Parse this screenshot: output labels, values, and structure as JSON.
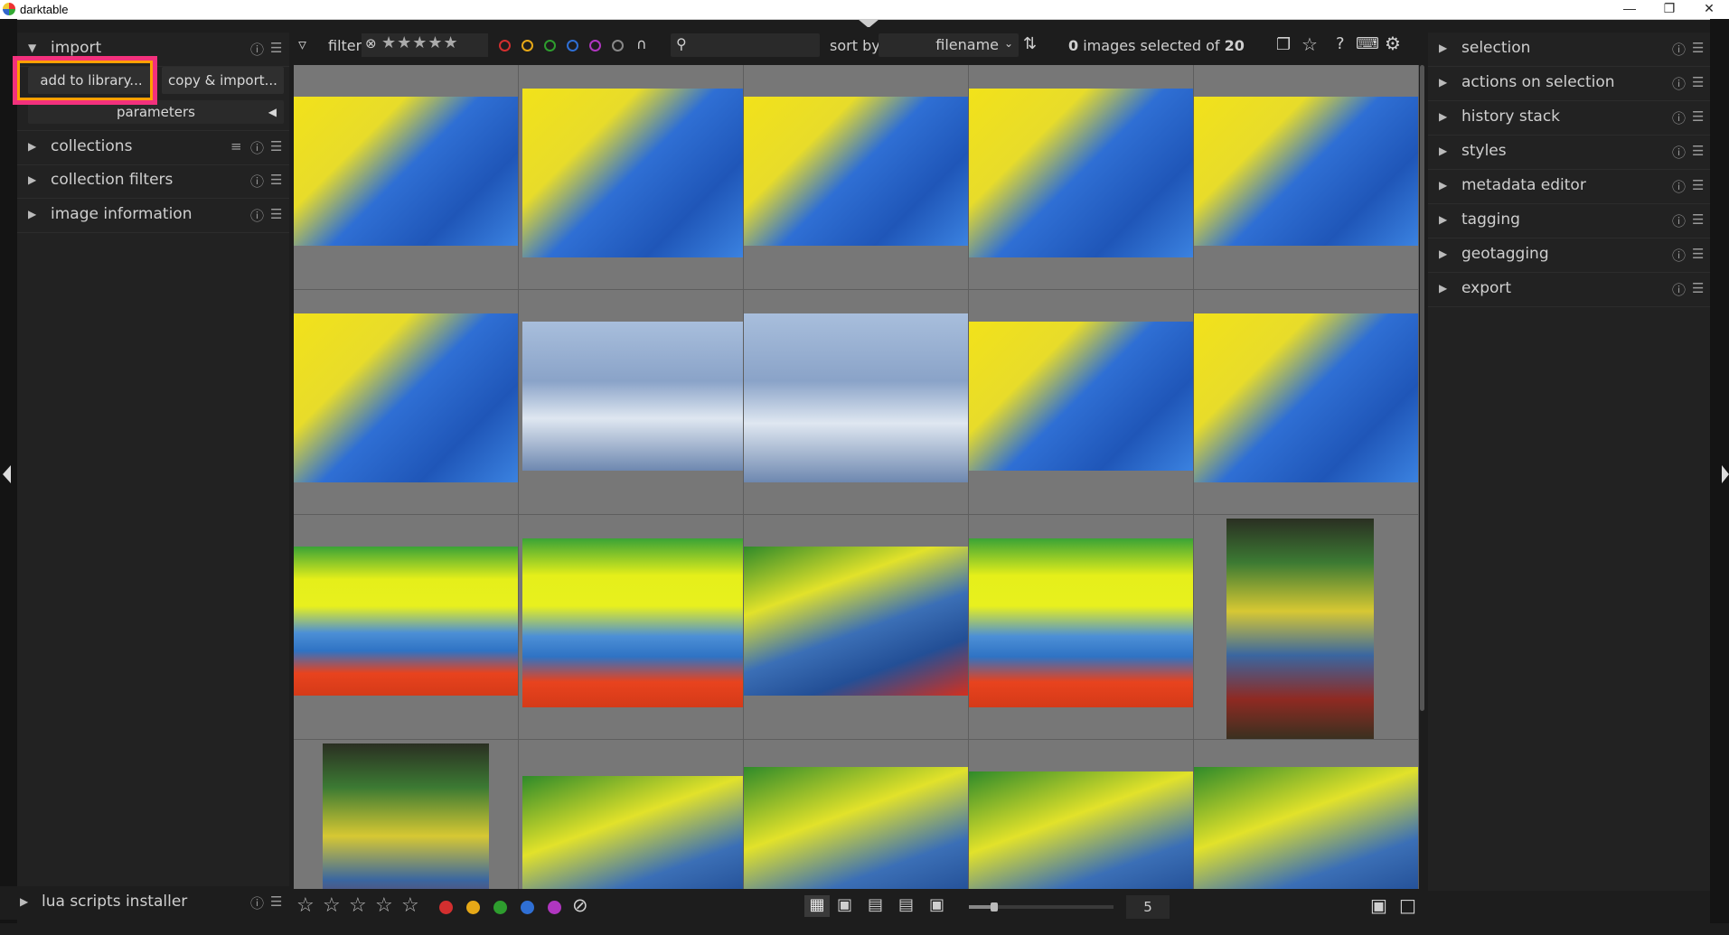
{
  "window": {
    "title": "darktable"
  },
  "left_panel": {
    "import": {
      "label": "import",
      "add_label": "add to library...",
      "copy_label": "copy & import...",
      "params_label": "parameters"
    },
    "modules": [
      "collections",
      "collection filters",
      "image information"
    ],
    "bottom_module": "lua scripts installer"
  },
  "topbar": {
    "filter_label": "filter",
    "sort_label": "sort by",
    "sort_value": "filename",
    "count": "0",
    "count_mid": " images selected of ",
    "total": "20",
    "color_labels": [
      "#d32f2f",
      "#e6a817",
      "#2e9d2e",
      "#2f6fd4",
      "#b036c0",
      "#888888"
    ]
  },
  "right_panel": {
    "modules": [
      "selection",
      "actions on selection",
      "history stack",
      "styles",
      "metadata editor",
      "tagging",
      "geotagging",
      "export"
    ]
  },
  "bottombar": {
    "zoom_value": "5",
    "color_labels": [
      "#d32f2f",
      "#e6a817",
      "#2e9d2e",
      "#2f6fd4",
      "#b036c0"
    ]
  },
  "thumbnails": [
    {
      "kind": "yb"
    },
    {
      "kind": "yb"
    },
    {
      "kind": "yb"
    },
    {
      "kind": "yb"
    },
    {
      "kind": "yb"
    },
    {
      "kind": "yb"
    },
    {
      "kind": "bike"
    },
    {
      "kind": "bike"
    },
    {
      "kind": "yb"
    },
    {
      "kind": "yb"
    },
    {
      "kind": "ybr"
    },
    {
      "kind": "ybr"
    },
    {
      "kind": "gybr"
    },
    {
      "kind": "ybr"
    },
    {
      "kind": "dark"
    },
    {
      "kind": "dark"
    },
    {
      "kind": "gybr"
    },
    {
      "kind": "gybr"
    },
    {
      "kind": "gybr"
    },
    {
      "kind": "gybr"
    }
  ]
}
